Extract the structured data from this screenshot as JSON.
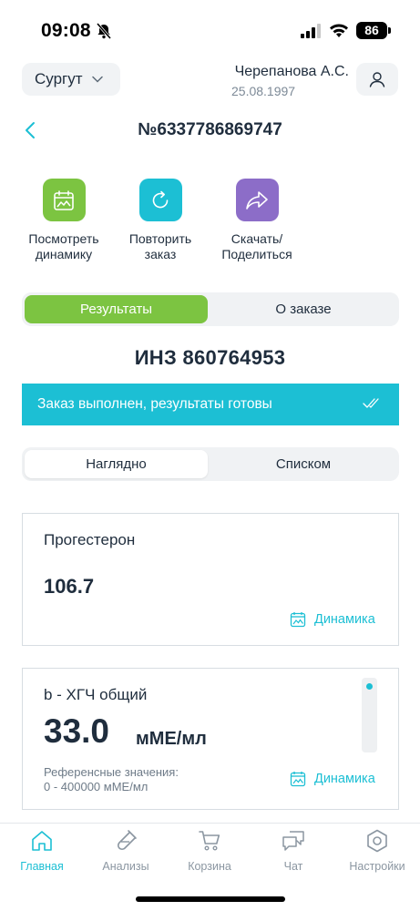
{
  "status_bar": {
    "time": "09:08",
    "battery": "86"
  },
  "header": {
    "city": "Сургут",
    "user_name": "Черепанова А.С.",
    "user_dob": "25.08.1997"
  },
  "order": {
    "number": "№6337786869747"
  },
  "actions": [
    {
      "label_line1": "Посмотреть",
      "label_line2": "динамику",
      "icon": "chart-calendar-icon"
    },
    {
      "label_line1": "Повторить",
      "label_line2": "заказ",
      "icon": "repeat-icon"
    },
    {
      "label_line1": "Скачать/",
      "label_line2": "Поделиться",
      "icon": "share-icon"
    }
  ],
  "main_tabs": {
    "results": "Результаты",
    "about": "О заказе",
    "selected": "results"
  },
  "inz": "ИНЗ 860764953",
  "status_banner": "Заказ выполнен, результаты готовы",
  "view_tabs": {
    "visual": "Наглядно",
    "list": "Списком",
    "selected": "visual"
  },
  "results": [
    {
      "name": "Прогестерон",
      "value": "106.7",
      "link": "Динамика"
    },
    {
      "name": "b - ХГЧ общий",
      "value": "33.0",
      "unit": "мМЕ/мл",
      "ref_label": "Референсные значения:",
      "ref_value": "0 - 400000 мМЕ/мл",
      "link": "Динамика"
    }
  ],
  "nav": [
    {
      "label": "Главная",
      "icon": "home-icon",
      "active": true
    },
    {
      "label": "Анализы",
      "icon": "test-tube-icon",
      "active": false
    },
    {
      "label": "Корзина",
      "icon": "cart-icon",
      "active": false
    },
    {
      "label": "Чат",
      "icon": "chat-icon",
      "active": false
    },
    {
      "label": "Настройки",
      "icon": "settings-icon",
      "active": false
    }
  ],
  "colors": {
    "accent": "#1cbfd4",
    "green": "#7cc441",
    "purple": "#8c6dc8",
    "text": "#1f2d3d"
  }
}
